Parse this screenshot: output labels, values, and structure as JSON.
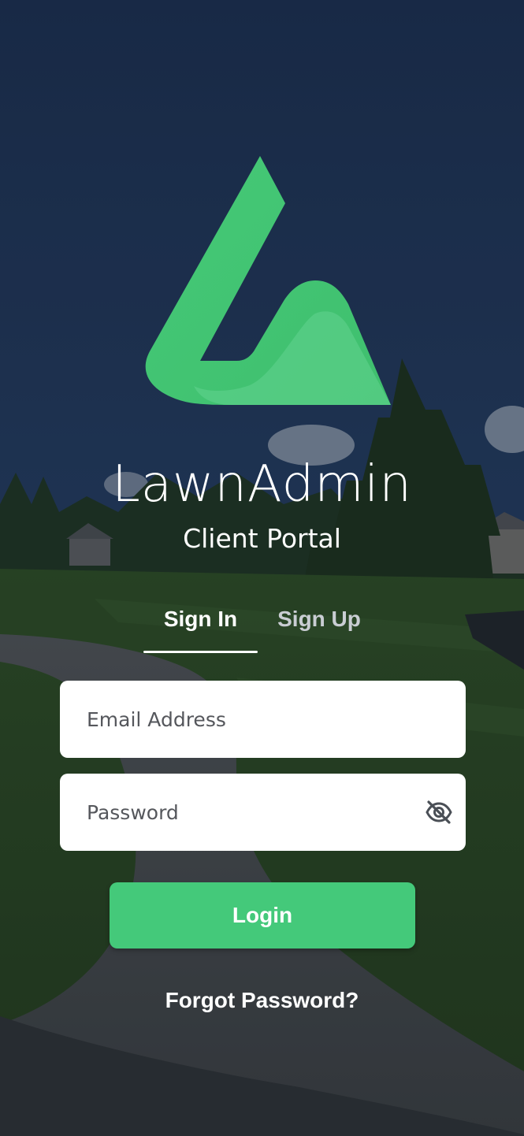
{
  "brand": {
    "logo_icon": "lawnadmin-logo-icon",
    "title": "LawnAdmin",
    "subtitle": "Client Portal",
    "accent_color": "#44c97a"
  },
  "tabs": [
    {
      "label": "Sign In",
      "active": true
    },
    {
      "label": "Sign Up",
      "active": false
    }
  ],
  "form": {
    "email": {
      "value": "",
      "placeholder": "Email Address"
    },
    "password": {
      "value": "",
      "placeholder": "Password",
      "toggle_icon": "eye-off-icon"
    },
    "login_label": "Login",
    "forgot_label": "Forgot Password?"
  },
  "background": {
    "description_icon": "lawn-background-photo",
    "sky_color": "#1e3050",
    "grass_color": "#2f4a24"
  }
}
